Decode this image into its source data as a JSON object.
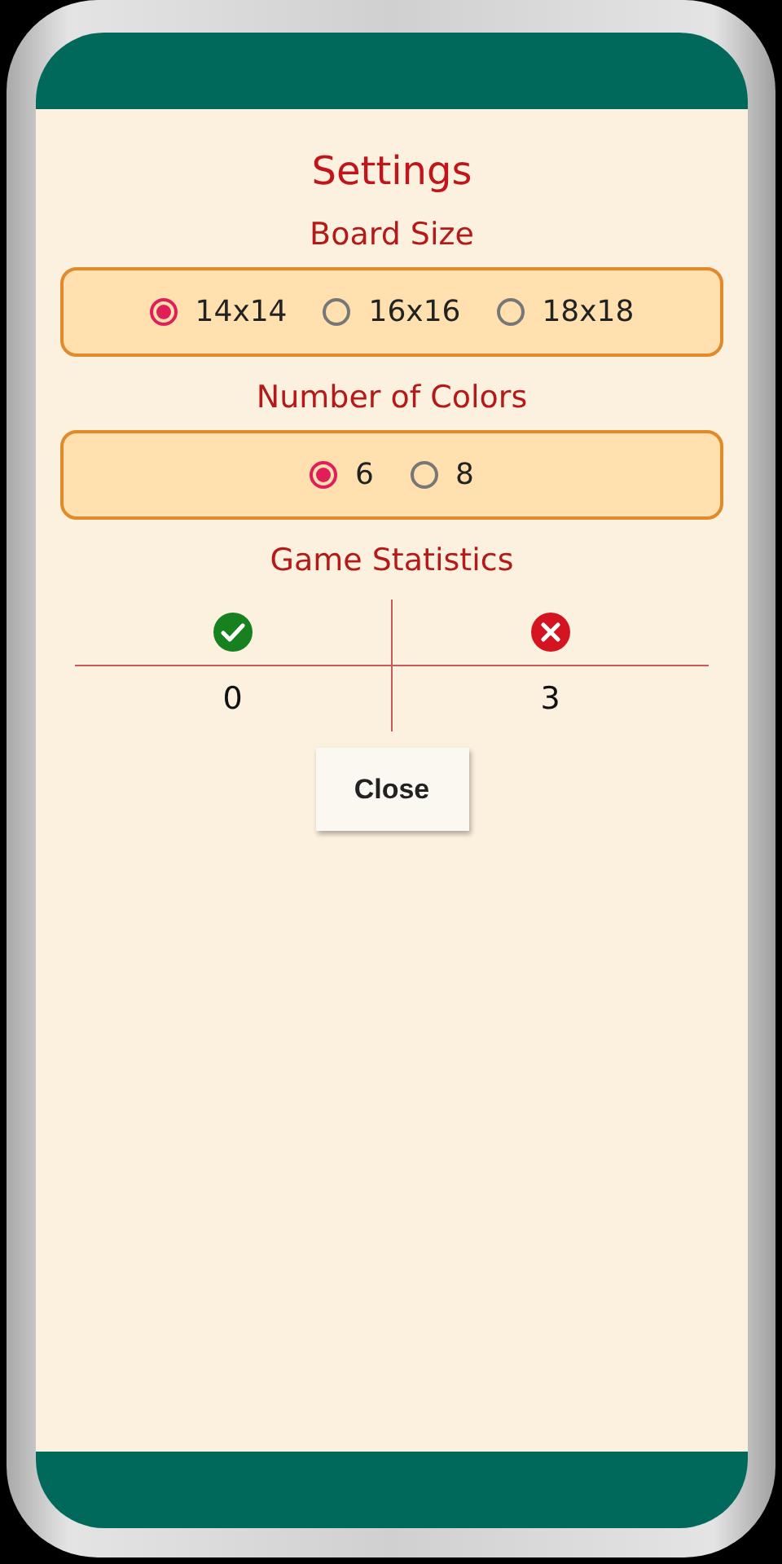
{
  "title": "Settings",
  "groups": [
    {
      "label": "Board Size",
      "options": [
        {
          "label": "14x14",
          "selected": true
        },
        {
          "label": "16x16",
          "selected": false
        },
        {
          "label": "18x18",
          "selected": false
        }
      ]
    },
    {
      "label": "Number of Colors",
      "options": [
        {
          "label": "6",
          "selected": true
        },
        {
          "label": "8",
          "selected": false
        }
      ]
    }
  ],
  "statistics": {
    "label": "Game Statistics",
    "columns": [
      {
        "kind": "won",
        "value": "0"
      },
      {
        "kind": "lost",
        "value": "3"
      }
    ]
  },
  "close_button": "Close"
}
